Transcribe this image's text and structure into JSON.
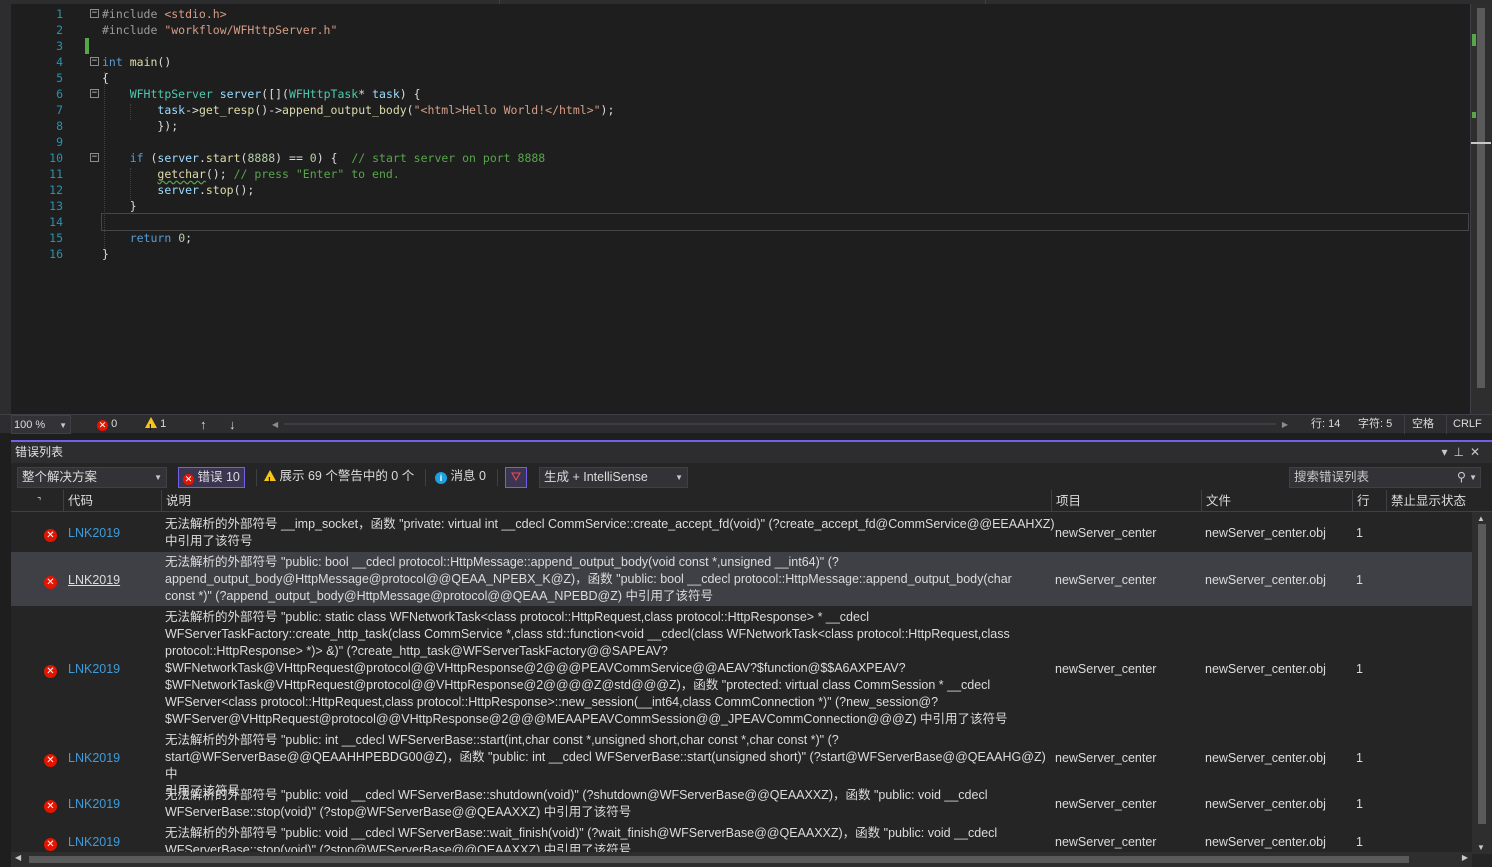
{
  "editor": {
    "line_numbers": [
      "1",
      "2",
      "3",
      "4",
      "5",
      "6",
      "7",
      "8",
      "9",
      "10",
      "11",
      "12",
      "13",
      "14",
      "15",
      "16"
    ],
    "lines": [
      "#include <stdio.h>",
      "#include \"workflow/WFHttpServer.h\"",
      "",
      "int main()",
      "{",
      "    WFHttpServer server([](WFHttpTask* task) {",
      "        task->get_resp()->append_output_body(\"<html>Hello World!</html>\");",
      "        });",
      "",
      "    if (server.start(8888) == 0) {  // start server on port 8888",
      "        getchar(); // press \"Enter\" to end.",
      "        server.stop();",
      "    }",
      "",
      "    return 0;",
      "}"
    ]
  },
  "status": {
    "zoom": "100 %",
    "errors": "0",
    "warnings": "1",
    "up_arrow": "↑",
    "down_arrow": "↓",
    "left_arrow": "◀",
    "right_arrow": "▶",
    "line": "行: 14",
    "col": "字符: 5",
    "whitespace": "空格",
    "eol": "CRLF"
  },
  "panel": {
    "title": "错误列表",
    "scope": "整个解决方案",
    "errors_btn": "错误 10",
    "warnings_btn": "展示 69 个警告中的 0 个",
    "messages_btn": "消息 0",
    "build_filter": "生成 + IntelliSense",
    "search_placeholder": "搜索错误列表",
    "columns": {
      "code": "代码",
      "desc": "说明",
      "project": "项目",
      "file": "文件",
      "line": "行",
      "suppress": "禁止显示状态"
    },
    "rows": [
      {
        "code": "LNK2019",
        "desc": "无法解析的外部符号 __imp_socket，函数 \"private: virtual int __cdecl CommService::create_accept_fd(void)\" (?create_accept_fd@CommService@@EEAAHXZ)\n中引用了该符号",
        "project": "newServer_center",
        "file": "newServer_center.obj",
        "line": "1"
      },
      {
        "code": "LNK2019",
        "desc": "无法解析的外部符号 \"public: bool __cdecl protocol::HttpMessage::append_output_body(void const *,unsigned __int64)\" (?\nappend_output_body@HttpMessage@protocol@@QEAA_NPEBX_K@Z)，函数 \"public: bool __cdecl protocol::HttpMessage::append_output_body(char\nconst *)\" (?append_output_body@HttpMessage@protocol@@QEAA_NPEBD@Z) 中引用了该符号",
        "project": "newServer_center",
        "file": "newServer_center.obj",
        "line": "1"
      },
      {
        "code": "LNK2019",
        "desc": "无法解析的外部符号 \"public: static class WFNetworkTask<class protocol::HttpRequest,class protocol::HttpResponse> * __cdecl\nWFServerTaskFactory::create_http_task(class CommService *,class std::function<void __cdecl(class WFNetworkTask<class protocol::HttpRequest,class\nprotocol::HttpResponse> *)> &)\" (?create_http_task@WFServerTaskFactory@@SAPEAV?\n$WFNetworkTask@VHttpRequest@protocol@@VHttpResponse@2@@@PEAVCommService@@AEAV?$function@$$A6AXPEAV?\n$WFNetworkTask@VHttpRequest@protocol@@VHttpResponse@2@@@@Z@std@@@Z)，函数 \"protected: virtual class CommSession * __cdecl\nWFServer<class protocol::HttpRequest,class protocol::HttpResponse>::new_session(__int64,class CommConnection *)\" (?new_session@?\n$WFServer@VHttpRequest@protocol@@VHttpResponse@2@@@MEAAPEAVCommSession@@_JPEAVCommConnection@@@Z) 中引用了该符号",
        "project": "newServer_center",
        "file": "newServer_center.obj",
        "line": "1"
      },
      {
        "code": "LNK2019",
        "desc": "无法解析的外部符号 \"public: int __cdecl WFServerBase::start(int,char const *,unsigned short,char const *,char const *)\" (?\nstart@WFServerBase@@QEAAHHPEBDG00@Z)，函数 \"public: int __cdecl WFServerBase::start(unsigned short)\" (?start@WFServerBase@@QEAAHG@Z) 中\n引用了该符号",
        "project": "newServer_center",
        "file": "newServer_center.obj",
        "line": "1"
      },
      {
        "code": "LNK2019",
        "desc": "无法解析的外部符号 \"public: void __cdecl WFServerBase::shutdown(void)\" (?shutdown@WFServerBase@@QEAAXXZ)，函数 \"public: void __cdecl\nWFServerBase::stop(void)\" (?stop@WFServerBase@@QEAAXXZ) 中引用了该符号",
        "project": "newServer_center",
        "file": "newServer_center.obj",
        "line": "1"
      },
      {
        "code": "LNK2019",
        "desc": "无法解析的外部符号 \"public: void __cdecl WFServerBase::wait_finish(void)\" (?wait_finish@WFServerBase@@QEAAXXZ)，函数 \"public: void __cdecl\nWFServerBase::stop(void)\" (?stop@WFServerBase@@QEAAXXZ) 中引用了该符号",
        "project": "newServer_center",
        "file": "newServer_center.obj",
        "line": "1"
      }
    ]
  }
}
